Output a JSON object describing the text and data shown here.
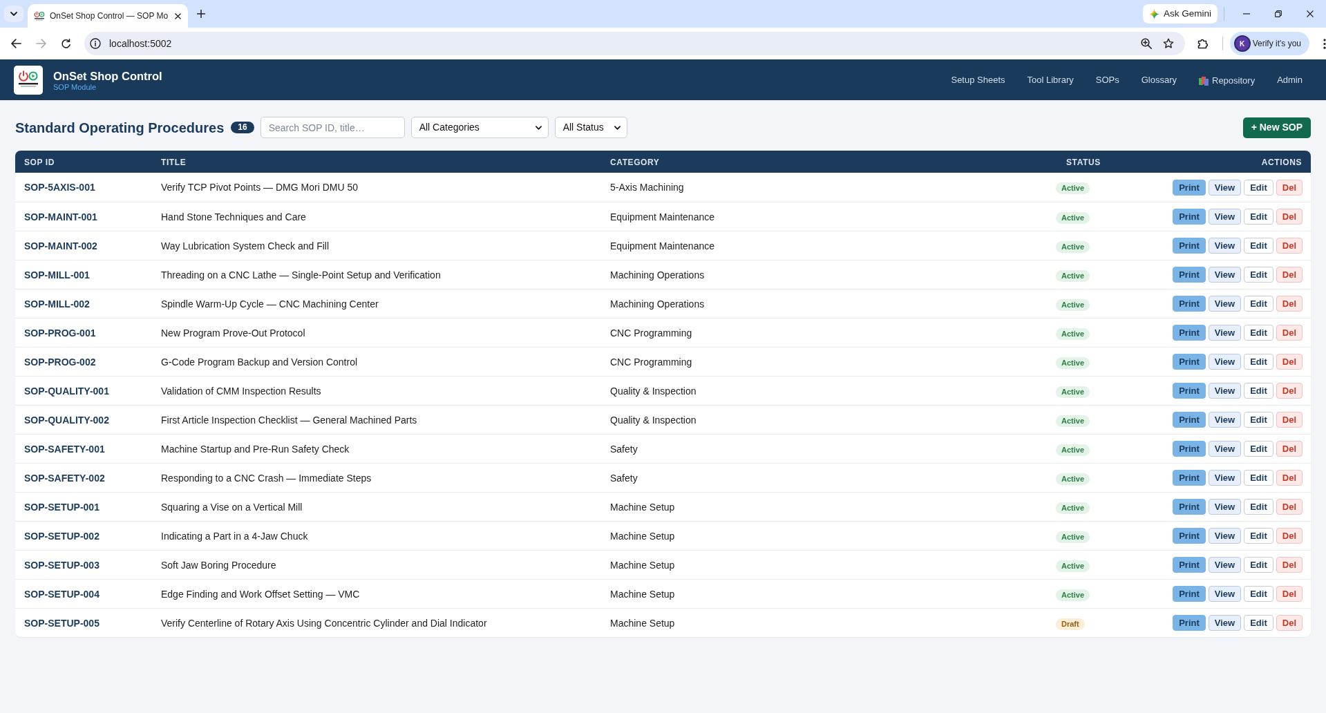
{
  "browser": {
    "tabs": [
      {
        "title": "OnSet Shop Control — SOP Mo",
        "selected": true
      }
    ],
    "gemini_button": "Ask Gemini",
    "forward_disabled": true,
    "address": "localhost:5002",
    "profile": {
      "label": "Verify it's you",
      "avatar": "K"
    }
  },
  "app": {
    "title": "OnSet Shop Control",
    "subtitle": "SOP Module",
    "nav": [
      {
        "label": "Setup Sheets",
        "kind": "link"
      },
      {
        "label": "Tool Library",
        "kind": "link"
      },
      {
        "label": "SOPs",
        "kind": "link"
      },
      {
        "label": "Glossary",
        "kind": "link"
      },
      {
        "label": "Repository",
        "kind": "icon-link"
      },
      {
        "label": "Admin",
        "kind": "link"
      }
    ]
  },
  "page": {
    "title": "Standard Operating Procedures",
    "count": "16",
    "search": {
      "placeholder": "Search SOP ID, title…"
    },
    "filters": [
      {
        "value": "All Categories"
      },
      {
        "value": "All Status"
      }
    ],
    "new_button": "+ New SOP"
  },
  "table": {
    "columns": [
      "SOP ID",
      "TITLE",
      "CATEGORY",
      "STATUS",
      "ACTIONS"
    ],
    "rows": [
      {
        "id": "SOP-5AXIS-001",
        "title": "Verify TCP Pivot Points — DMG Mori DMU 50",
        "category": "5-Axis Machining",
        "status": {
          "label": "Active",
          "kind": "active"
        },
        "actions": [
          {
            "label": "Print",
            "kind": "print"
          },
          {
            "label": "View",
            "kind": "view"
          },
          {
            "label": "Edit",
            "kind": "edit"
          },
          {
            "label": "Del",
            "kind": "delete"
          }
        ]
      },
      {
        "id": "SOP-MAINT-001",
        "title": "Hand Stone Techniques and Care",
        "category": "Equipment Maintenance",
        "status": {
          "label": "Active",
          "kind": "active"
        },
        "actions": [
          {
            "label": "Print",
            "kind": "print"
          },
          {
            "label": "View",
            "kind": "view"
          },
          {
            "label": "Edit",
            "kind": "edit"
          },
          {
            "label": "Del",
            "kind": "delete"
          }
        ]
      },
      {
        "id": "SOP-MAINT-002",
        "title": "Way Lubrication System Check and Fill",
        "category": "Equipment Maintenance",
        "status": {
          "label": "Active",
          "kind": "active"
        },
        "actions": [
          {
            "label": "Print",
            "kind": "print"
          },
          {
            "label": "View",
            "kind": "view"
          },
          {
            "label": "Edit",
            "kind": "edit"
          },
          {
            "label": "Del",
            "kind": "delete"
          }
        ]
      },
      {
        "id": "SOP-MILL-001",
        "title": "Threading on a CNC Lathe — Single-Point Setup and Verification",
        "category": "Machining Operations",
        "status": {
          "label": "Active",
          "kind": "active"
        },
        "actions": [
          {
            "label": "Print",
            "kind": "print"
          },
          {
            "label": "View",
            "kind": "view"
          },
          {
            "label": "Edit",
            "kind": "edit"
          },
          {
            "label": "Del",
            "kind": "delete"
          }
        ]
      },
      {
        "id": "SOP-MILL-002",
        "title": "Spindle Warm-Up Cycle — CNC Machining Center",
        "category": "Machining Operations",
        "status": {
          "label": "Active",
          "kind": "active"
        },
        "actions": [
          {
            "label": "Print",
            "kind": "print"
          },
          {
            "label": "View",
            "kind": "view"
          },
          {
            "label": "Edit",
            "kind": "edit"
          },
          {
            "label": "Del",
            "kind": "delete"
          }
        ]
      },
      {
        "id": "SOP-PROG-001",
        "title": "New Program Prove-Out Protocol",
        "category": "CNC Programming",
        "status": {
          "label": "Active",
          "kind": "active"
        },
        "actions": [
          {
            "label": "Print",
            "kind": "print"
          },
          {
            "label": "View",
            "kind": "view"
          },
          {
            "label": "Edit",
            "kind": "edit"
          },
          {
            "label": "Del",
            "kind": "delete"
          }
        ]
      },
      {
        "id": "SOP-PROG-002",
        "title": "G-Code Program Backup and Version Control",
        "category": "CNC Programming",
        "status": {
          "label": "Active",
          "kind": "active"
        },
        "actions": [
          {
            "label": "Print",
            "kind": "print"
          },
          {
            "label": "View",
            "kind": "view"
          },
          {
            "label": "Edit",
            "kind": "edit"
          },
          {
            "label": "Del",
            "kind": "delete"
          }
        ]
      },
      {
        "id": "SOP-QUALITY-001",
        "title": "Validation of CMM Inspection Results",
        "category": "Quality & Inspection",
        "status": {
          "label": "Active",
          "kind": "active"
        },
        "actions": [
          {
            "label": "Print",
            "kind": "print"
          },
          {
            "label": "View",
            "kind": "view"
          },
          {
            "label": "Edit",
            "kind": "edit"
          },
          {
            "label": "Del",
            "kind": "delete"
          }
        ]
      },
      {
        "id": "SOP-QUALITY-002",
        "title": "First Article Inspection Checklist — General Machined Parts",
        "category": "Quality & Inspection",
        "status": {
          "label": "Active",
          "kind": "active"
        },
        "actions": [
          {
            "label": "Print",
            "kind": "print"
          },
          {
            "label": "View",
            "kind": "view"
          },
          {
            "label": "Edit",
            "kind": "edit"
          },
          {
            "label": "Del",
            "kind": "delete"
          }
        ]
      },
      {
        "id": "SOP-SAFETY-001",
        "title": "Machine Startup and Pre-Run Safety Check",
        "category": "Safety",
        "status": {
          "label": "Active",
          "kind": "active"
        },
        "actions": [
          {
            "label": "Print",
            "kind": "print"
          },
          {
            "label": "View",
            "kind": "view"
          },
          {
            "label": "Edit",
            "kind": "edit"
          },
          {
            "label": "Del",
            "kind": "delete"
          }
        ]
      },
      {
        "id": "SOP-SAFETY-002",
        "title": "Responding to a CNC Crash — Immediate Steps",
        "category": "Safety",
        "status": {
          "label": "Active",
          "kind": "active"
        },
        "actions": [
          {
            "label": "Print",
            "kind": "print"
          },
          {
            "label": "View",
            "kind": "view"
          },
          {
            "label": "Edit",
            "kind": "edit"
          },
          {
            "label": "Del",
            "kind": "delete"
          }
        ]
      },
      {
        "id": "SOP-SETUP-001",
        "title": "Squaring a Vise on a Vertical Mill",
        "category": "Machine Setup",
        "status": {
          "label": "Active",
          "kind": "active"
        },
        "actions": [
          {
            "label": "Print",
            "kind": "print"
          },
          {
            "label": "View",
            "kind": "view"
          },
          {
            "label": "Edit",
            "kind": "edit"
          },
          {
            "label": "Del",
            "kind": "delete"
          }
        ]
      },
      {
        "id": "SOP-SETUP-002",
        "title": "Indicating a Part in a 4-Jaw Chuck",
        "category": "Machine Setup",
        "status": {
          "label": "Active",
          "kind": "active"
        },
        "actions": [
          {
            "label": "Print",
            "kind": "print"
          },
          {
            "label": "View",
            "kind": "view"
          },
          {
            "label": "Edit",
            "kind": "edit"
          },
          {
            "label": "Del",
            "kind": "delete"
          }
        ]
      },
      {
        "id": "SOP-SETUP-003",
        "title": "Soft Jaw Boring Procedure",
        "category": "Machine Setup",
        "status": {
          "label": "Active",
          "kind": "active"
        },
        "actions": [
          {
            "label": "Print",
            "kind": "print"
          },
          {
            "label": "View",
            "kind": "view"
          },
          {
            "label": "Edit",
            "kind": "edit"
          },
          {
            "label": "Del",
            "kind": "delete"
          }
        ]
      },
      {
        "id": "SOP-SETUP-004",
        "title": "Edge Finding and Work Offset Setting — VMC",
        "category": "Machine Setup",
        "status": {
          "label": "Active",
          "kind": "active"
        },
        "actions": [
          {
            "label": "Print",
            "kind": "print"
          },
          {
            "label": "View",
            "kind": "view"
          },
          {
            "label": "Edit",
            "kind": "edit"
          },
          {
            "label": "Del",
            "kind": "delete"
          }
        ]
      },
      {
        "id": "SOP-SETUP-005",
        "title": "Verify Centerline of Rotary Axis Using Concentric Cylinder and Dial Indicator",
        "category": "Machine Setup",
        "status": {
          "label": "Draft",
          "kind": "draft"
        },
        "actions": [
          {
            "label": "Print",
            "kind": "print"
          },
          {
            "label": "View",
            "kind": "view"
          },
          {
            "label": "Edit",
            "kind": "edit"
          },
          {
            "label": "Del",
            "kind": "delete"
          }
        ]
      }
    ]
  }
}
